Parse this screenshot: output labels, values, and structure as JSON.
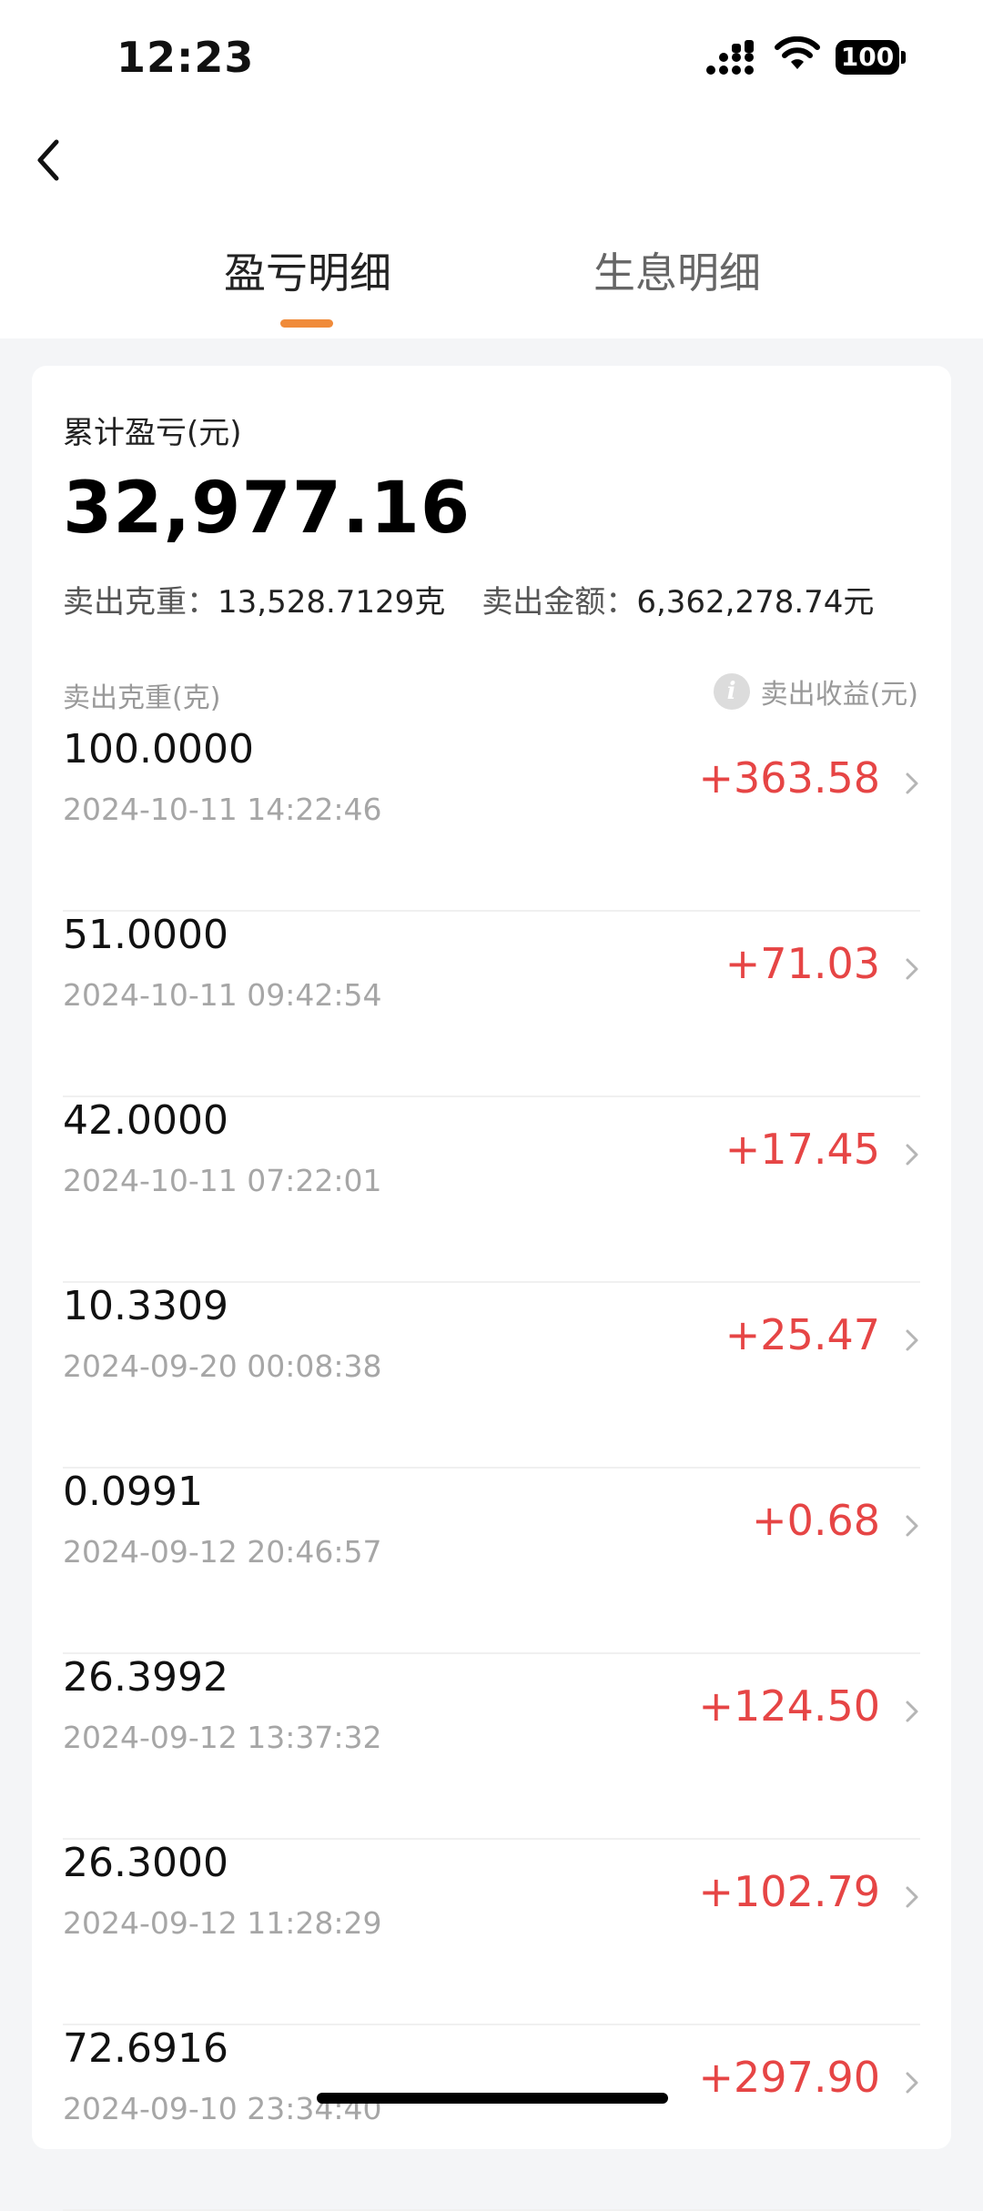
{
  "status_bar": {
    "time": "12:23",
    "battery": "100"
  },
  "tabs": [
    {
      "label": "盈亏明细",
      "active": true
    },
    {
      "label": "生息明细",
      "active": false
    }
  ],
  "summary": {
    "label": "累计盈亏(元)",
    "total": "32,977.16",
    "sold_weight_label": "卖出克重：",
    "sold_weight_value": "13,528.7129克",
    "sold_amount_label": "卖出金额：",
    "sold_amount_value": "6,362,278.74元"
  },
  "columns": {
    "left": "卖出克重(克)",
    "right": "卖出收益(元)"
  },
  "records": [
    {
      "weight": "100.0000",
      "time": "2024-10-11 14:22:46",
      "profit": "+363.58"
    },
    {
      "weight": "51.0000",
      "time": "2024-10-11 09:42:54",
      "profit": "+71.03"
    },
    {
      "weight": "42.0000",
      "time": "2024-10-11 07:22:01",
      "profit": "+17.45"
    },
    {
      "weight": "10.3309",
      "time": "2024-09-20 00:08:38",
      "profit": "+25.47"
    },
    {
      "weight": "0.0991",
      "time": "2024-09-12 20:46:57",
      "profit": "+0.68"
    },
    {
      "weight": "26.3992",
      "time": "2024-09-12 13:37:32",
      "profit": "+124.50"
    },
    {
      "weight": "26.3000",
      "time": "2024-09-12 11:28:29",
      "profit": "+102.79"
    },
    {
      "weight": "72.6916",
      "time": "2024-09-10 23:34:40",
      "profit": "+297.90"
    }
  ],
  "colors": {
    "accent": "#f08b3a",
    "profit": "#e64545",
    "muted": "#a6a6a6"
  }
}
